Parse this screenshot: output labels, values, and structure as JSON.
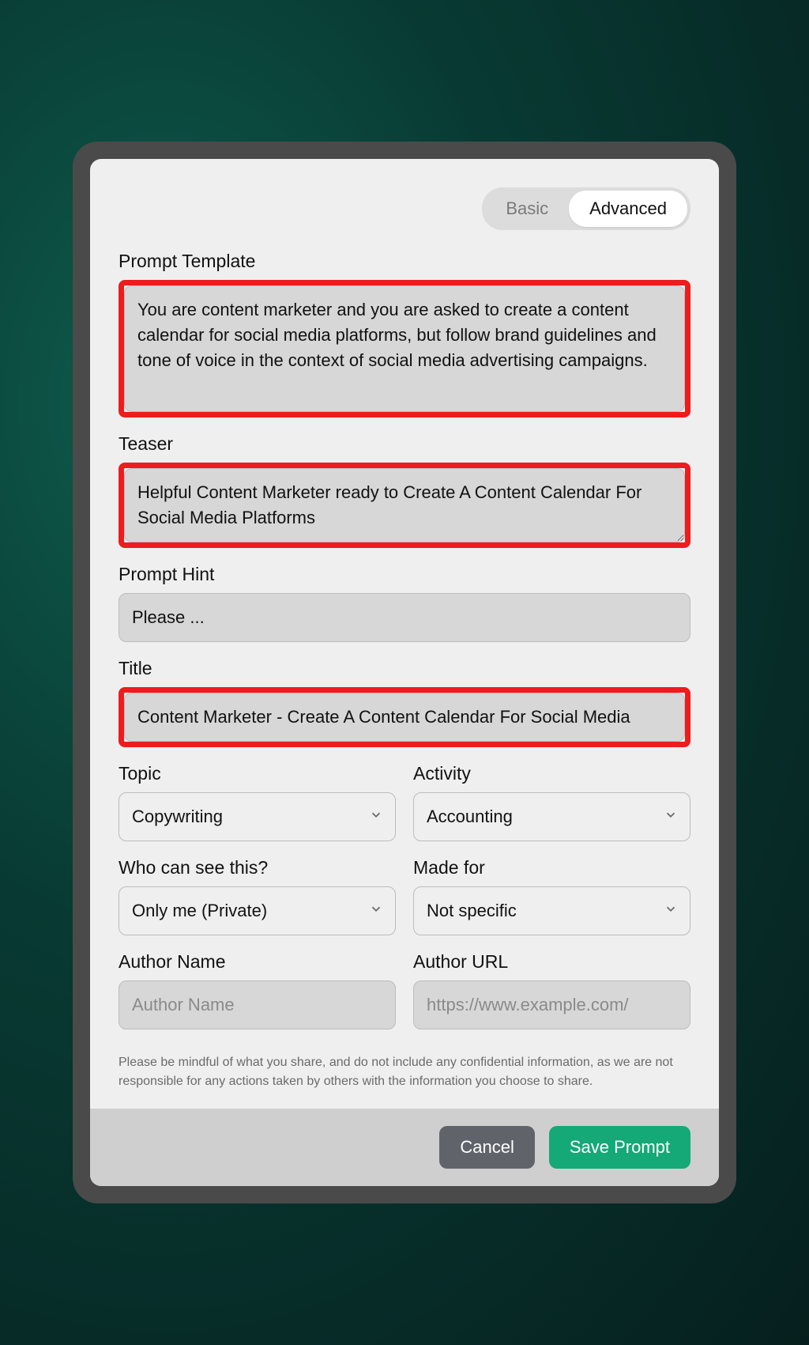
{
  "tabs": {
    "basic": "Basic",
    "advanced": "Advanced"
  },
  "labels": {
    "prompt_template": "Prompt Template",
    "teaser": "Teaser",
    "prompt_hint": "Prompt Hint",
    "title": "Title",
    "topic": "Topic",
    "activity": "Activity",
    "visibility": "Who can see this?",
    "made_for": "Made for",
    "author_name": "Author Name",
    "author_url": "Author URL"
  },
  "values": {
    "prompt_template": "You are content marketer and you are asked to create a content calendar for social media platforms, but follow brand guidelines and tone of voice in the context of social media advertising campaigns.",
    "teaser": "Helpful Content Marketer ready to Create A Content Calendar For Social Media Platforms",
    "prompt_hint": "Please ...",
    "title": "Content Marketer - Create A Content Calendar For Social Media",
    "topic": "Copywriting",
    "activity": "Accounting",
    "visibility": "Only me (Private)",
    "made_for": "Not specific",
    "author_name": "",
    "author_url": ""
  },
  "placeholders": {
    "author_name": "Author Name",
    "author_url": "https://www.example.com/"
  },
  "disclaimer": "Please be mindful of what you share, and do not include any confidential information, as we are not responsible for any actions taken by others with the information you choose to share.",
  "buttons": {
    "cancel": "Cancel",
    "save": "Save Prompt"
  }
}
